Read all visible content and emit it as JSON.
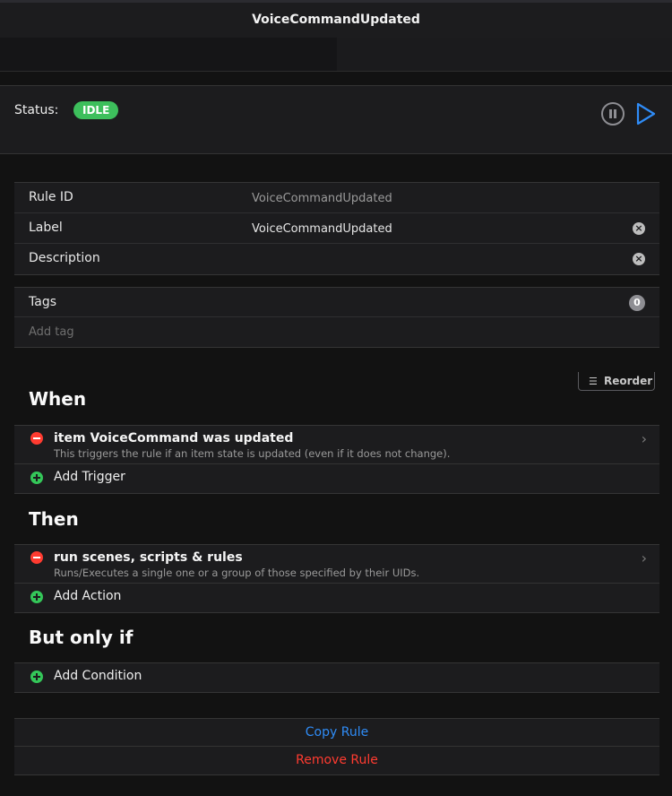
{
  "header": {
    "title": "VoiceCommandUpdated"
  },
  "status": {
    "label": "Status:",
    "badge": "IDLE",
    "badge_color": "#3dbf5c"
  },
  "rule_info": {
    "rule_id_label": "Rule ID",
    "rule_id_value": "VoiceCommandUpdated",
    "label_label": "Label",
    "label_value": "VoiceCommandUpdated",
    "description_label": "Description",
    "description_value": ""
  },
  "tags": {
    "label": "Tags",
    "count": "0",
    "placeholder": "Add tag"
  },
  "reorder": {
    "label": "Reorder",
    "icon": "reorder-icon"
  },
  "when": {
    "title": "When",
    "items": [
      {
        "title": "item VoiceCommand was updated",
        "subtitle": "This triggers the rule if an item state is updated (even if it does not change)."
      }
    ],
    "add_label": "Add Trigger"
  },
  "then": {
    "title": "Then",
    "items": [
      {
        "title": "run scenes, scripts & rules",
        "subtitle": "Runs/Executes a single one or a group of those specified by their UIDs."
      }
    ],
    "add_label": "Add Action"
  },
  "only_if": {
    "title": "But only if",
    "add_label": "Add Condition"
  },
  "actions": {
    "copy_label": "Copy Rule",
    "copy_color": "#2f8cf7",
    "remove_label": "Remove Rule",
    "remove_color": "#ff3b30"
  },
  "colors": {
    "accent": "#2f8cf7",
    "danger": "#ff3b30",
    "success": "#34c759"
  }
}
